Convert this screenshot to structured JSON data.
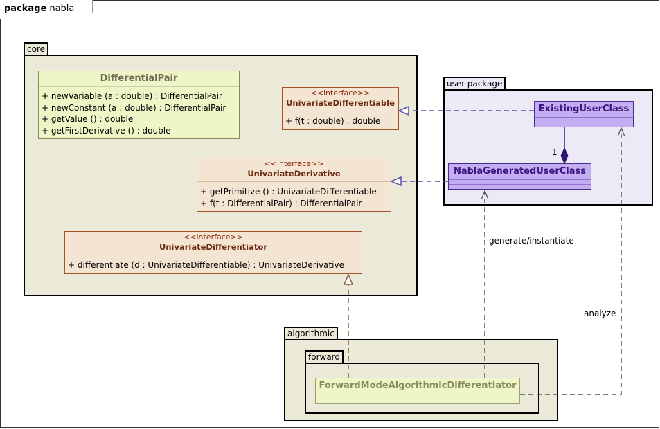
{
  "frame": {
    "keyword": "package",
    "name": "nabla"
  },
  "packages": {
    "core": "core",
    "user_package": "user-package",
    "algorithmic": "algorithmic",
    "forward": "forward"
  },
  "classes": {
    "differential_pair": {
      "name": "DifferentialPair",
      "ops": [
        "+ newVariable (a : double) : DifferentialPair",
        "+ newConstant (a : double) : DifferentialPair",
        "+ getValue () : double",
        "+ getFirstDerivative () : double"
      ]
    },
    "univariate_differentiable": {
      "stereotype": "<<interface>>",
      "name": "UnivariateDifferentiable",
      "ops": [
        "+ f(t : double) : double"
      ]
    },
    "univariate_derivative": {
      "stereotype": "<<interface>>",
      "name": "UnivariateDerivative",
      "ops": [
        "+ getPrimitive () : UnivariateDifferentiable",
        "+ f(t : DifferentialPair) : DifferentialPair"
      ]
    },
    "univariate_differentiator": {
      "stereotype": "<<interface>>",
      "name": "UnivariateDifferentiator",
      "ops": [
        "+ differentiate (d : UnivariateDifferentiable) : UnivariateDerivative"
      ]
    },
    "existing_user_class": {
      "name": "ExistingUserClass"
    },
    "nabla_generated_user_class": {
      "name": "NablaGeneratedUserClass"
    },
    "forward_mode": {
      "name": "ForwardModeAlgorithmicDifferentiator"
    }
  },
  "links": {
    "multiplicity": "1",
    "generate_label": "generate/instantiate",
    "analyze_label": "analyze"
  },
  "colors": {
    "package_fill": "#ebe9d8",
    "user_package_fill": "#eceaf6",
    "class_fill": "#eef6c7",
    "interface_fill": "#f4e4d2",
    "user_class_fill": "#c3aef2",
    "realization_user": "#5a4fa8",
    "realization_core": "#8b5a3c"
  }
}
